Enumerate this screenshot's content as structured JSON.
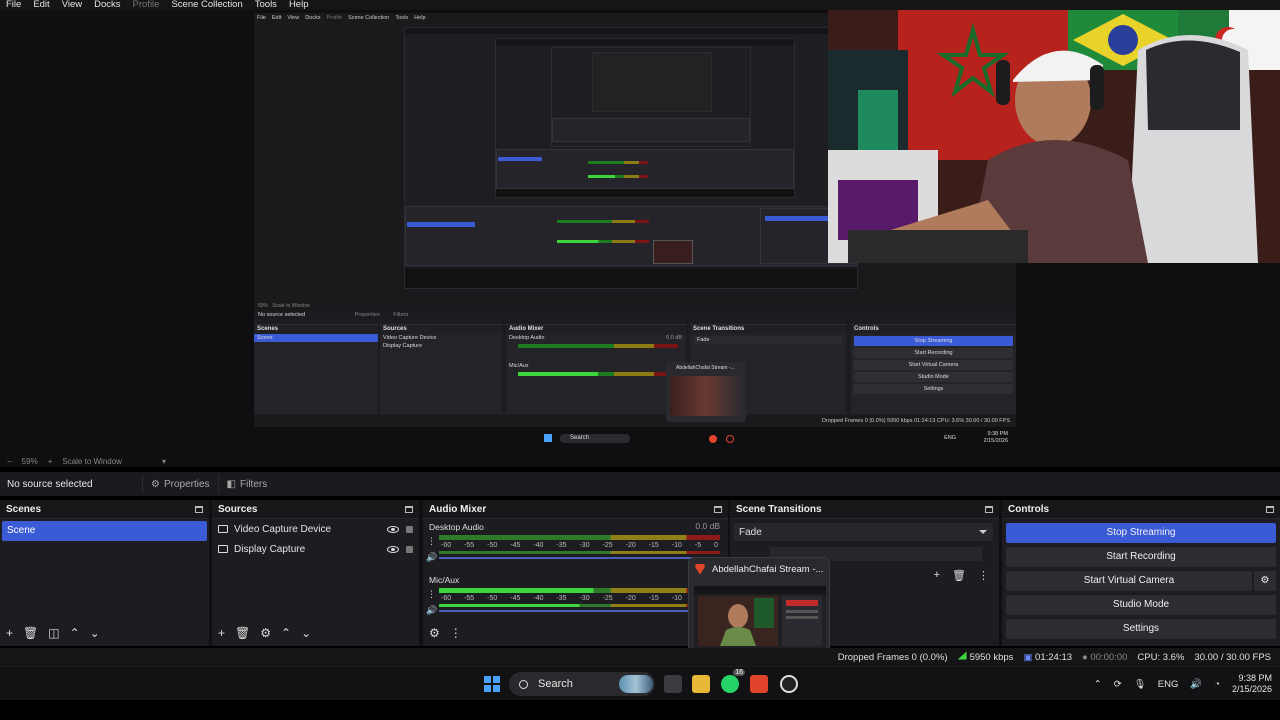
{
  "menu": {
    "items": [
      "File",
      "Edit",
      "View",
      "Docks",
      "Profile",
      "Scene Collection",
      "Tools",
      "Help"
    ],
    "disabled": [
      "Profile"
    ]
  },
  "preview": {
    "zoom": "59%",
    "scale_mode": "Scale to Window",
    "inner": {
      "menu": [
        "File",
        "Edit",
        "View",
        "Docks",
        "Profile",
        "Scene Collection",
        "Tools",
        "Help"
      ],
      "zoom": "59%",
      "scale_mode": "Scale to Window",
      "no_source": "No source selected",
      "properties": "Properties",
      "filters": "Filters",
      "scenes_title": "Scenes",
      "scene_item": "Scene",
      "sources_title": "Sources",
      "sources": [
        "Video Capture Device",
        "Display Capture"
      ],
      "mixer_title": "Audio Mixer",
      "desktop_audio": "Desktop Audio",
      "db": "0.0 dB",
      "mic": "Mic/Aux",
      "transitions_title": "Scene Transitions",
      "transition": "Fade",
      "controls_title": "Controls",
      "controls": [
        "Stop Streaming",
        "Start Recording",
        "Start Virtual Camera",
        "Studio Mode",
        "Settings"
      ],
      "thumb_title": "AbdellahChafai Stream -...",
      "status": "Dropped Frames 0 (0.0%)   5950 kbps   01:24:13   CPU: 3.6%   30.00 / 30.00 FPS",
      "search": "Search",
      "tray": "ENG",
      "clock_time": "9:38 PM",
      "clock_date": "2/15/2026"
    }
  },
  "context": {
    "no_source": "No source selected",
    "properties": "Properties",
    "filters": "Filters"
  },
  "scenes": {
    "title": "Scenes",
    "items": [
      "Scene"
    ]
  },
  "sources": {
    "title": "Sources",
    "items": [
      "Video Capture Device",
      "Display Capture"
    ]
  },
  "mixer": {
    "title": "Audio Mixer",
    "channels": [
      {
        "name": "Desktop Audio",
        "db": "0.0 dB",
        "level": 0
      },
      {
        "name": "Mic/Aux",
        "db": "",
        "level": 0.55
      }
    ],
    "scale": [
      "-60",
      "-55",
      "-50",
      "-45",
      "-40",
      "-35",
      "-30",
      "-25",
      "-20",
      "-15",
      "-10",
      "-5",
      "0"
    ]
  },
  "transitions": {
    "title": "Scene Transitions",
    "selected": "Fade"
  },
  "controls": {
    "title": "Controls",
    "stop_streaming": "Stop Streaming",
    "start_recording": "Start Recording",
    "start_virtual_camera": "Start Virtual Camera",
    "studio_mode": "Studio Mode",
    "settings": "Settings"
  },
  "status": {
    "dropped": "Dropped Frames 0 (0.0%)",
    "bitrate": "5950 kbps",
    "stream_time": "01:24:13",
    "rec_time": "00:00:00",
    "cpu": "CPU: 3.6%",
    "fps": "30.00 / 30.00 FPS"
  },
  "thumbnail": {
    "title": "AbdellahChafai Stream -..."
  },
  "taskbar": {
    "search": "Search",
    "whatsapp_badge": "16",
    "lang": "ENG",
    "time": "9:38 PM",
    "date": "2/15/2026"
  },
  "colors": {
    "accent": "#3b5bd6",
    "meter_green": "#3ed43e",
    "brave": "#e2432b"
  }
}
